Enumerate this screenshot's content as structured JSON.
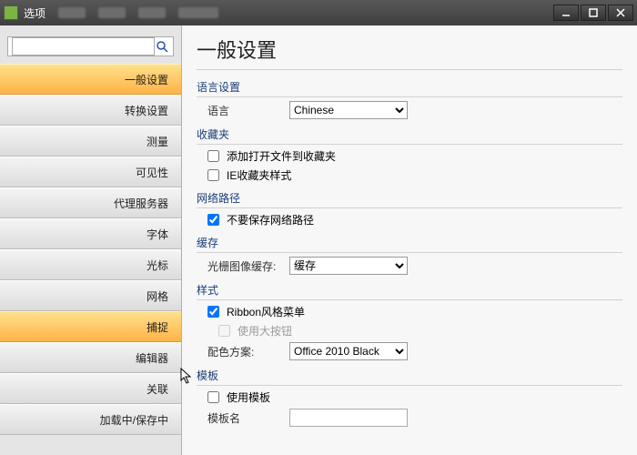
{
  "window": {
    "title": "选项"
  },
  "sidebar": {
    "search_placeholder": "",
    "items": [
      {
        "label": "一般设置",
        "selected": true
      },
      {
        "label": "转换设置"
      },
      {
        "label": "测量"
      },
      {
        "label": "可见性"
      },
      {
        "label": "代理服务器"
      },
      {
        "label": "字体"
      },
      {
        "label": "光标"
      },
      {
        "label": "网格"
      },
      {
        "label": "捕捉",
        "hover": true
      },
      {
        "label": "编辑器"
      },
      {
        "label": "关联"
      },
      {
        "label": "加载中/保存中"
      }
    ]
  },
  "main": {
    "heading": "一般设置",
    "lang": {
      "section": "语言设置",
      "label": "语言",
      "value": "Chinese"
    },
    "fav": {
      "section": "收藏夹",
      "opt1": "添加打开文件到收藏夹",
      "opt1_checked": false,
      "opt2": "IE收藏夹样式",
      "opt2_checked": false
    },
    "netpath": {
      "section": "网络路径",
      "opt": "不要保存网络路径",
      "checked": true
    },
    "cache": {
      "section": "缓存",
      "label": "光栅图像缓存:",
      "value": "缓存"
    },
    "style": {
      "section": "样式",
      "ribbon": "Ribbon风格菜单",
      "ribbon_checked": true,
      "bigbtn": "使用大按钮",
      "bigbtn_checked": false,
      "scheme_label": "配色方案:",
      "scheme_value": "Office 2010 Black"
    },
    "template": {
      "section": "模板",
      "use": "使用模板",
      "use_checked": false,
      "name_label": "模板名",
      "name_value": ""
    }
  }
}
